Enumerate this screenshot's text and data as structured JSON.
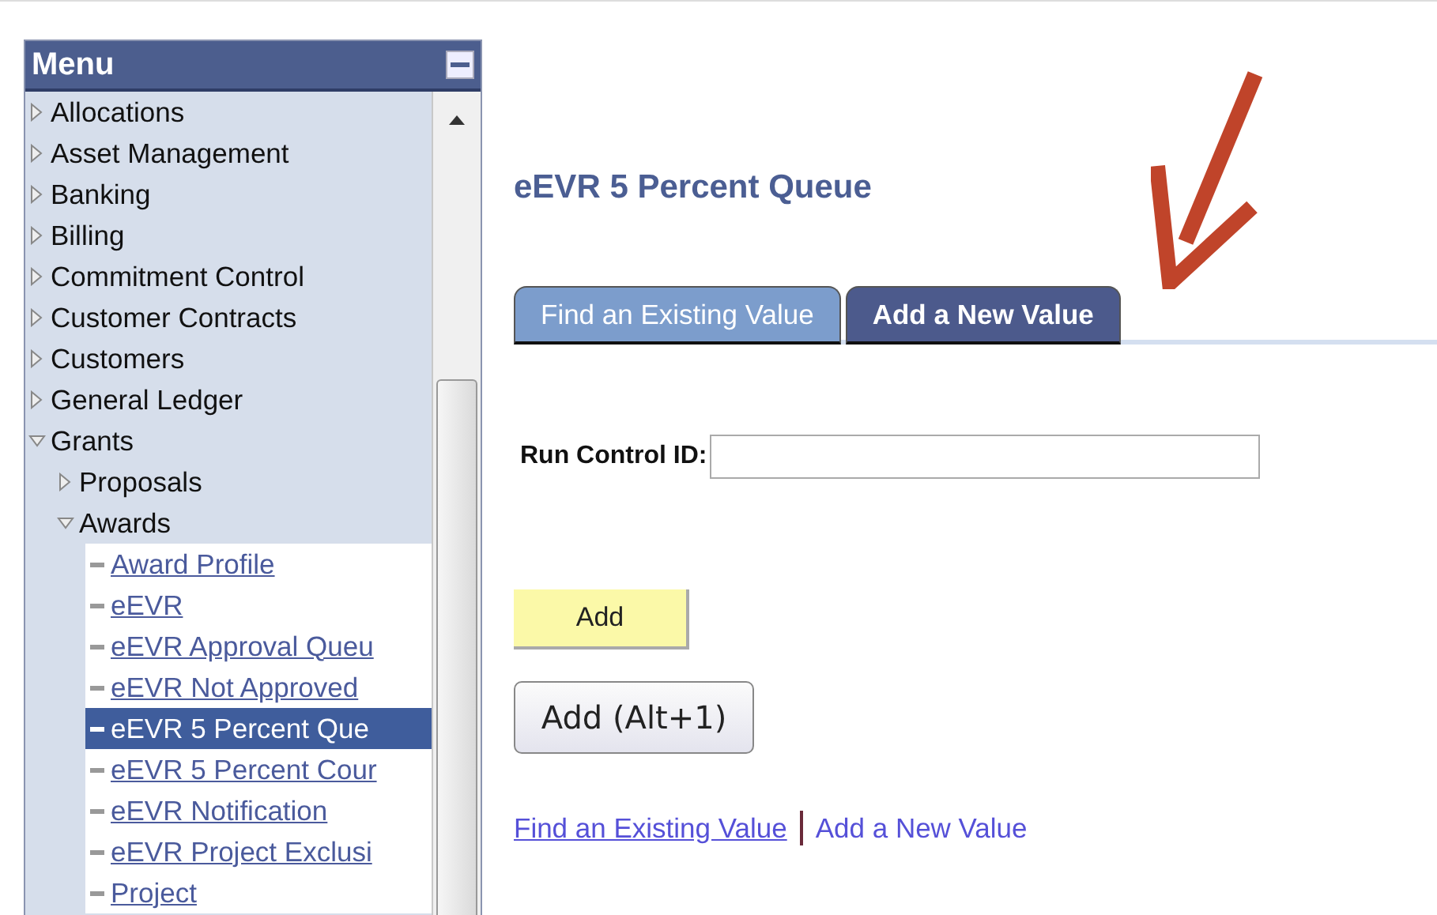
{
  "menu": {
    "title": "Menu",
    "items": [
      {
        "kind": "folder",
        "label": "Allocations",
        "expanded": false
      },
      {
        "kind": "folder",
        "label": "Asset Management",
        "expanded": false
      },
      {
        "kind": "folder",
        "label": "Banking",
        "expanded": false
      },
      {
        "kind": "folder",
        "label": "Billing",
        "expanded": false
      },
      {
        "kind": "folder",
        "label": "Commitment Control",
        "expanded": false
      },
      {
        "kind": "folder",
        "label": "Customer Contracts",
        "expanded": false
      },
      {
        "kind": "folder",
        "label": "Customers",
        "expanded": false
      },
      {
        "kind": "folder",
        "label": "General Ledger",
        "expanded": false
      },
      {
        "kind": "folder",
        "label": "Grants",
        "expanded": true,
        "children": [
          {
            "kind": "folder",
            "label": "Proposals",
            "expanded": false
          },
          {
            "kind": "folder",
            "label": "Awards",
            "expanded": true,
            "children": [
              {
                "kind": "link",
                "label": "Award Profile",
                "selected": false
              },
              {
                "kind": "link",
                "label": "eEVR",
                "selected": false
              },
              {
                "kind": "link",
                "label": "eEVR Approval Queu",
                "selected": false
              },
              {
                "kind": "link",
                "label": "eEVR Not Approved",
                "selected": false
              },
              {
                "kind": "link",
                "label": "eEVR 5 Percent Que",
                "selected": true
              },
              {
                "kind": "link",
                "label": "eEVR 5 Percent Cour",
                "selected": false
              },
              {
                "kind": "link",
                "label": "eEVR Notification",
                "selected": false
              },
              {
                "kind": "link",
                "label": "eEVR Project Exclusi",
                "selected": false
              },
              {
                "kind": "link",
                "label": "Project",
                "selected": false
              }
            ]
          }
        ]
      }
    ]
  },
  "page_title": "eEVR 5 Percent Queue",
  "tabs": [
    {
      "label": "Find an Existing Value",
      "selected": false
    },
    {
      "label": "Add a New Value",
      "selected": true
    }
  ],
  "run_control": {
    "label": "Run Control ID:"
  },
  "add_button": "Add",
  "add_alt_button": "Add (Alt+1)",
  "links": [
    {
      "label": "Find an Existing Value",
      "underlined": true
    },
    {
      "label": "Add a New Value",
      "underlined": false
    }
  ]
}
